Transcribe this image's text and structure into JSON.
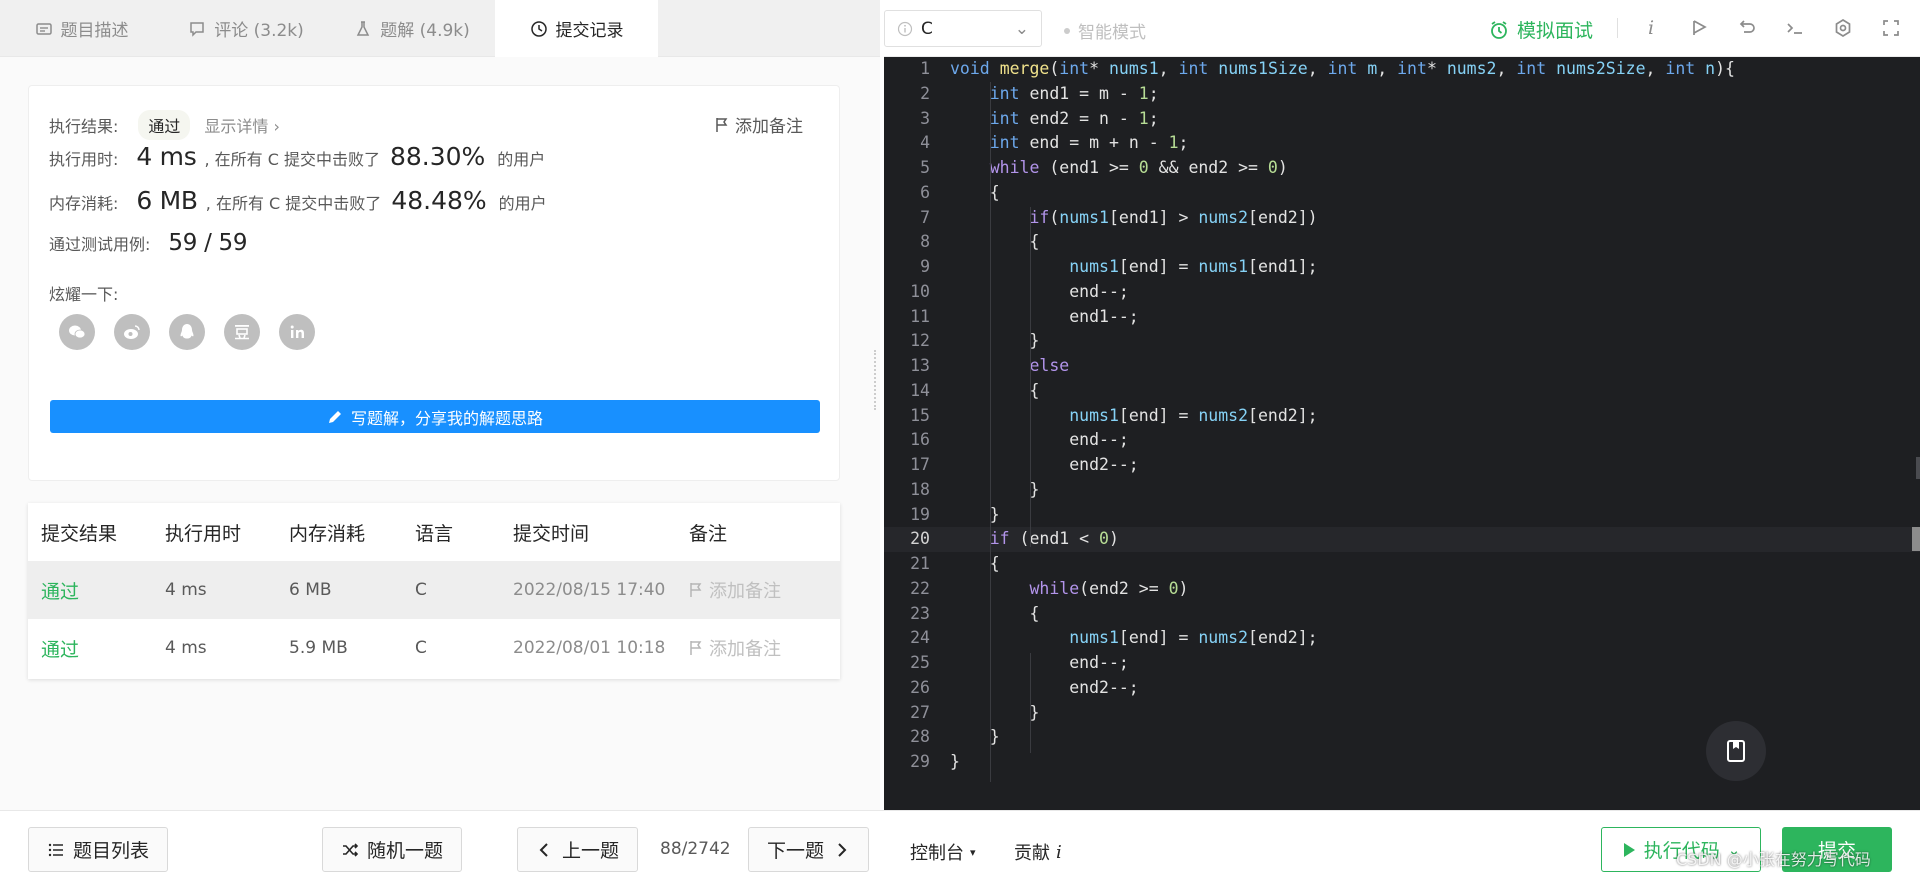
{
  "tabs": [
    {
      "label": "题目描述",
      "icon": "description-icon"
    },
    {
      "label": "评论 (3.2k)",
      "icon": "comment-icon"
    },
    {
      "label": "题解 (4.9k)",
      "icon": "flask-icon"
    },
    {
      "label": "提交记录",
      "icon": "clock-icon"
    }
  ],
  "result": {
    "exec_result_label": "执行结果:",
    "status": "通过",
    "detail_link": "显示详情 ›",
    "add_note": "添加备注",
    "time_label": "执行用时:",
    "time_value": "4 ms",
    "time_text": ", 在所有 C 提交中击败了",
    "time_pct": "88.30%",
    "users_suffix": "的用户",
    "mem_label": "内存消耗:",
    "mem_value": "6 MB",
    "mem_text": ", 在所有 C 提交中击败了",
    "mem_pct": "48.48%",
    "tests_label": "通过测试用例:",
    "tests_value": "59 / 59",
    "share_label": "炫耀一下:",
    "share_icons": [
      "wechat-icon",
      "weibo-icon",
      "qq-icon",
      "douban-icon",
      "linkedin-icon"
    ],
    "write_solution": "写题解，分享我的解题思路"
  },
  "submissions": {
    "headers": [
      "提交结果",
      "执行用时",
      "内存消耗",
      "语言",
      "提交时间",
      "备注"
    ],
    "rows": [
      {
        "result": "通过",
        "time": "4 ms",
        "memory": "6 MB",
        "lang": "C",
        "submitted": "2022/08/15 17:40",
        "note": "添加备注"
      },
      {
        "result": "通过",
        "time": "4 ms",
        "memory": "5.9 MB",
        "lang": "C",
        "submitted": "2022/08/01 10:18",
        "note": "添加备注"
      }
    ]
  },
  "bottom": {
    "problem_list": "题目列表",
    "random": "随机一题",
    "prev": "上一题",
    "page": "88/2742",
    "next": "下一题",
    "console": "控制台",
    "contribute": "贡献",
    "run": "执行代码",
    "submit": "提交",
    "watermark": "CSDN @小张在努力写代码"
  },
  "editor_toolbar": {
    "language": "C",
    "smart_mode": "智能模式",
    "mock_interview": "模拟面试",
    "icons": [
      "info-icon",
      "play-outline-icon",
      "reset-icon",
      "terminal-icon",
      "settings-icon",
      "fullscreen-icon"
    ]
  },
  "editor": {
    "current_line": 20,
    "lines": [
      [
        [
          "ty",
          "void"
        ],
        [
          "pl",
          " "
        ],
        [
          "fn",
          "merge"
        ],
        [
          "pl",
          "("
        ],
        [
          "ty",
          "int"
        ],
        [
          "pl",
          "* "
        ],
        [
          "id",
          "nums1"
        ],
        [
          "pl",
          ", "
        ],
        [
          "ty",
          "int"
        ],
        [
          "pl",
          " "
        ],
        [
          "id",
          "nums1Size"
        ],
        [
          "pl",
          ", "
        ],
        [
          "ty",
          "int"
        ],
        [
          "pl",
          " "
        ],
        [
          "id",
          "m"
        ],
        [
          "pl",
          ", "
        ],
        [
          "ty",
          "int"
        ],
        [
          "pl",
          "* "
        ],
        [
          "id",
          "nums2"
        ],
        [
          "pl",
          ", "
        ],
        [
          "ty",
          "int"
        ],
        [
          "pl",
          " "
        ],
        [
          "id",
          "nums2Size"
        ],
        [
          "pl",
          ", "
        ],
        [
          "ty",
          "int"
        ],
        [
          "pl",
          " "
        ],
        [
          "id",
          "n"
        ],
        [
          "pl",
          "){"
        ]
      ],
      [
        [
          "pl",
          "    "
        ],
        [
          "ty",
          "int"
        ],
        [
          "pl",
          " end1 = m - "
        ],
        [
          "nm",
          "1"
        ],
        [
          "pl",
          ";"
        ]
      ],
      [
        [
          "pl",
          "    "
        ],
        [
          "ty",
          "int"
        ],
        [
          "pl",
          " end2 = n - "
        ],
        [
          "nm",
          "1"
        ],
        [
          "pl",
          ";"
        ]
      ],
      [
        [
          "pl",
          "    "
        ],
        [
          "ty",
          "int"
        ],
        [
          "pl",
          " end = m + n - "
        ],
        [
          "nm",
          "1"
        ],
        [
          "pl",
          ";"
        ]
      ],
      [
        [
          "pl",
          "    "
        ],
        [
          "kw",
          "while"
        ],
        [
          "pl",
          " (end1 >= "
        ],
        [
          "nm",
          "0"
        ],
        [
          "pl",
          " && end2 >= "
        ],
        [
          "nm",
          "0"
        ],
        [
          "pl",
          ")"
        ]
      ],
      [
        [
          "pl",
          "    {"
        ]
      ],
      [
        [
          "pl",
          "        "
        ],
        [
          "kw",
          "if"
        ],
        [
          "pl",
          "("
        ],
        [
          "id",
          "nums1"
        ],
        [
          "pl",
          "[end1] > "
        ],
        [
          "id",
          "nums2"
        ],
        [
          "pl",
          "[end2])"
        ]
      ],
      [
        [
          "pl",
          "        {"
        ]
      ],
      [
        [
          "pl",
          "            "
        ],
        [
          "id",
          "nums1"
        ],
        [
          "pl",
          "[end] = "
        ],
        [
          "id",
          "nums1"
        ],
        [
          "pl",
          "[end1];"
        ]
      ],
      [
        [
          "pl",
          "            end--;"
        ]
      ],
      [
        [
          "pl",
          "            end1--;"
        ]
      ],
      [
        [
          "pl",
          "        }"
        ]
      ],
      [
        [
          "pl",
          "        "
        ],
        [
          "kw",
          "else"
        ]
      ],
      [
        [
          "pl",
          "        {"
        ]
      ],
      [
        [
          "pl",
          "            "
        ],
        [
          "id",
          "nums1"
        ],
        [
          "pl",
          "[end] = "
        ],
        [
          "id",
          "nums2"
        ],
        [
          "pl",
          "[end2];"
        ]
      ],
      [
        [
          "pl",
          "            end--;"
        ]
      ],
      [
        [
          "pl",
          "            end2--;"
        ]
      ],
      [
        [
          "pl",
          "        }"
        ]
      ],
      [
        [
          "pl",
          "    }"
        ]
      ],
      [
        [
          "pl",
          "    "
        ],
        [
          "kw",
          "if"
        ],
        [
          "pl",
          " (end1 < "
        ],
        [
          "nm",
          "0"
        ],
        [
          "pl",
          ")"
        ]
      ],
      [
        [
          "pl",
          "    {"
        ]
      ],
      [
        [
          "pl",
          "        "
        ],
        [
          "kw",
          "while"
        ],
        [
          "pl",
          "(end2 >= "
        ],
        [
          "nm",
          "0"
        ],
        [
          "pl",
          ")"
        ]
      ],
      [
        [
          "pl",
          "        {"
        ]
      ],
      [
        [
          "pl",
          "            "
        ],
        [
          "id",
          "nums1"
        ],
        [
          "pl",
          "[end] = "
        ],
        [
          "id",
          "nums2"
        ],
        [
          "pl",
          "[end2];"
        ]
      ],
      [
        [
          "pl",
          "            end--;"
        ]
      ],
      [
        [
          "pl",
          "            end2--;"
        ]
      ],
      [
        [
          "pl",
          "        }"
        ]
      ],
      [
        [
          "pl",
          "    }"
        ]
      ],
      [
        [
          "pl",
          "}"
        ]
      ]
    ]
  },
  "colors": {
    "accent_green": "#2db55d",
    "accent_blue": "#1890ff",
    "editor_bg": "#1e1f22"
  }
}
